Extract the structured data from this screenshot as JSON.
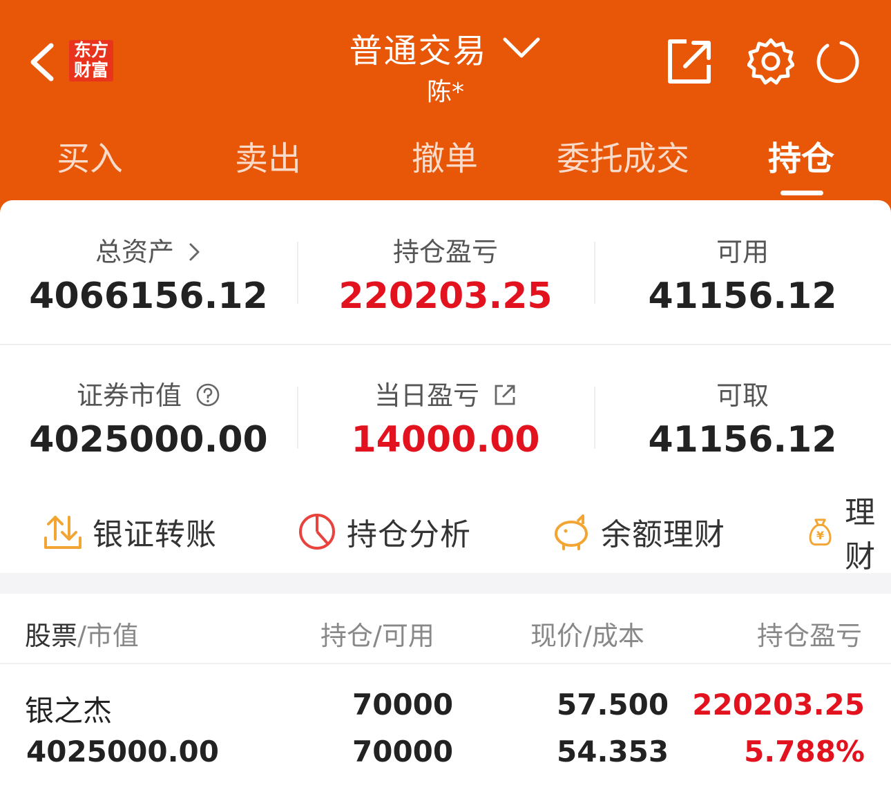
{
  "header": {
    "logo_line1": "东方",
    "logo_line2": "财富",
    "title": "普通交易",
    "subtitle": "陈*"
  },
  "tabs": [
    {
      "label": "买入"
    },
    {
      "label": "卖出"
    },
    {
      "label": "撤单"
    },
    {
      "label": "委托成交"
    },
    {
      "label": "持仓"
    }
  ],
  "stats": {
    "total_assets_label": "总资产",
    "total_assets_value": "4066156.12",
    "holding_pnl_label": "持仓盈亏",
    "holding_pnl_value": "220203.25",
    "available_label": "可用",
    "available_value": "41156.12",
    "market_value_label": "证券市值",
    "market_value_value": "4025000.00",
    "daily_pnl_label": "当日盈亏",
    "daily_pnl_value": "14000.00",
    "withdrawable_label": "可取",
    "withdrawable_value": "41156.12"
  },
  "actions": [
    {
      "label": "银证转账"
    },
    {
      "label": "持仓分析"
    },
    {
      "label": "余额理财"
    },
    {
      "label": "理财"
    }
  ],
  "table": {
    "headers": {
      "stock": "股票",
      "market_value": "/市值",
      "holding": "持仓",
      "available": "/可用",
      "price": "现价",
      "cost": "/成本",
      "pnl": "持仓盈亏"
    },
    "rows": [
      {
        "name": "银之杰",
        "market_value": "4025000.00",
        "holding": "70000",
        "available": "70000",
        "price": "57.500",
        "cost": "54.353",
        "pnl": "220203.25",
        "pnl_pct": "5.788%"
      }
    ]
  },
  "colors": {
    "brand": "#e85607",
    "profit_red": "#e2131f",
    "action_icon_orange": "#f3a533",
    "action_icon_red": "#e8433d"
  }
}
